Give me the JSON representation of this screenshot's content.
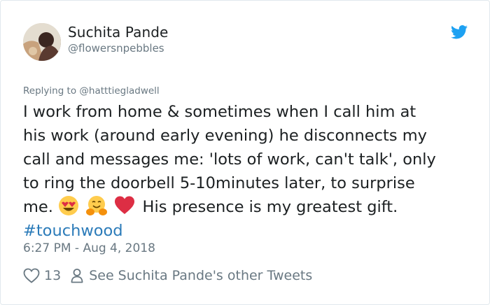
{
  "user": {
    "name": "Suchita Pande",
    "handle": "@flowersnpebbles",
    "avatar_icon": "profile-photo"
  },
  "brand": {
    "icon": "twitter-bird-icon",
    "color": "#1da1f2"
  },
  "reply": {
    "prefix": "Replying to ",
    "to": "@hatttiegladwell"
  },
  "tweet": {
    "lines": [
      "I work from home & sometimes when I call him at",
      "his work (around early evening) he disconnects my",
      "call and messages me: 'lots of work, can't talk', only",
      "to ring the doorbell 5-10minutes later, to surprise"
    ],
    "line5_start": "me.",
    "line5_emojis": [
      "heart-eyes-emoji",
      "hugging-face-emoji",
      "red-heart-emoji"
    ],
    "line5_end": "His presence is my greatest gift.",
    "hashtag": "#touchwood"
  },
  "timestamp": "6:27 PM - Aug 4, 2018",
  "actions": {
    "like_count": "13",
    "like_icon": "heart-outline-icon",
    "profile_link_icon": "person-icon",
    "profile_link": "See Suchita Pande's other Tweets"
  },
  "colors": {
    "text": "#1c2022",
    "secondary": "#697882",
    "link": "#2b7bb9"
  }
}
